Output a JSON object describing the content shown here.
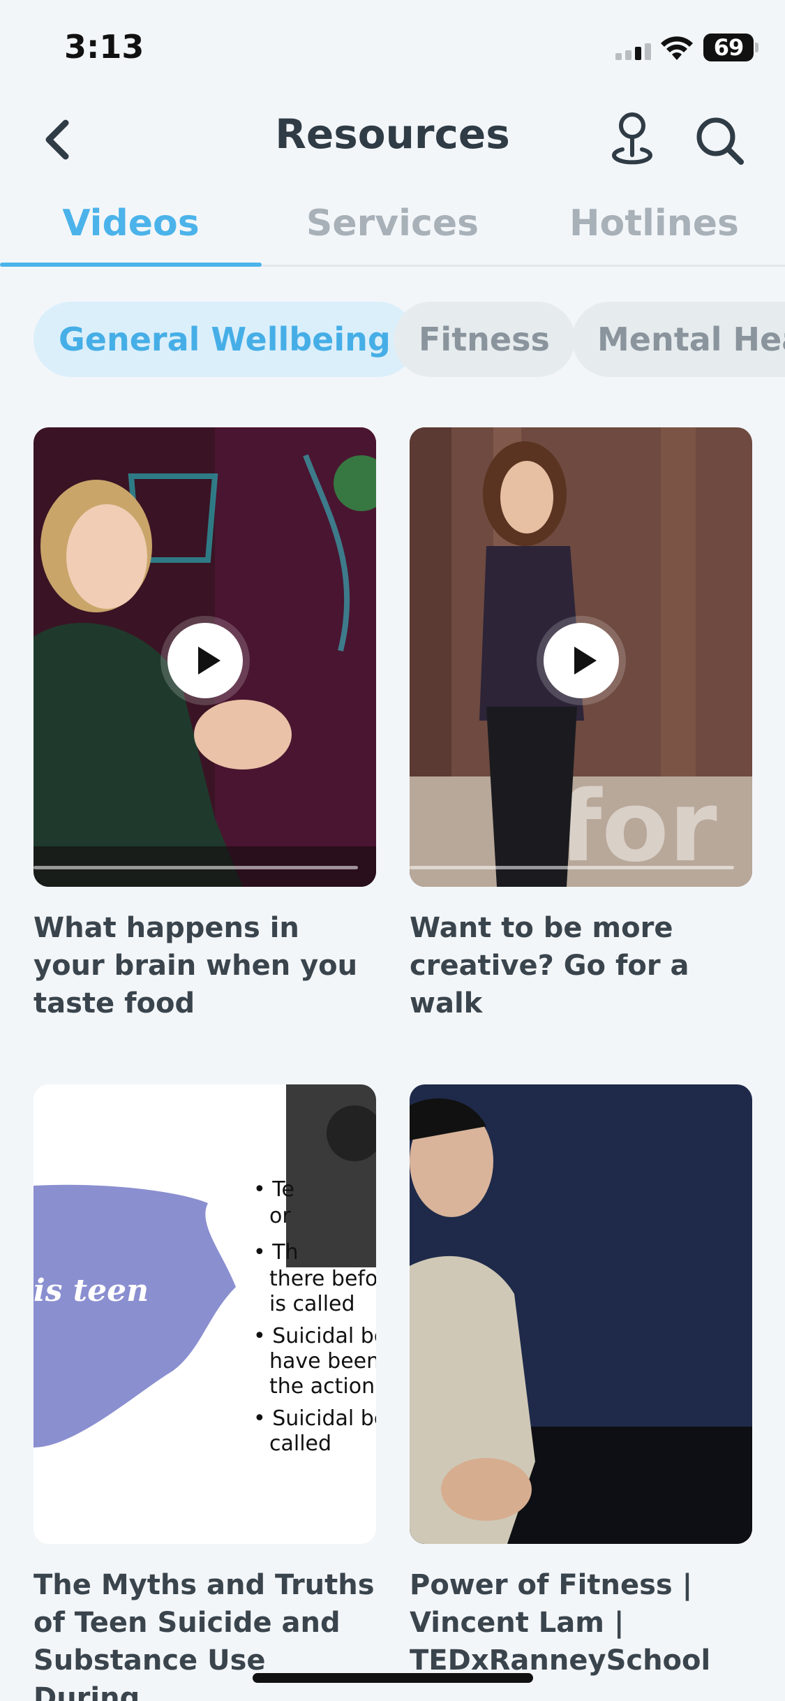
{
  "status_bar": {
    "time": "3:13",
    "battery": "69"
  },
  "header": {
    "title": "Resources"
  },
  "tabs": [
    {
      "label": "Videos",
      "active": true
    },
    {
      "label": "Services",
      "active": false
    },
    {
      "label": "Hotlines",
      "active": false
    }
  ],
  "chips": [
    {
      "label": "General Wellbeing",
      "active": true
    },
    {
      "label": "Fitness",
      "active": false
    },
    {
      "label": "Mental Heal",
      "active": false
    }
  ],
  "videos": [
    {
      "title": "What happens in your brain when you taste food",
      "has_play": true
    },
    {
      "title": "Want to be more creative? Go for a walk",
      "has_play": true
    },
    {
      "title": "The Myths and Truths of Teen Suicide and Substance Use During...",
      "has_play": false
    },
    {
      "title": "Power of Fitness | Vincent Lam | TEDxRanneySchool",
      "has_play": false
    }
  ],
  "colors": {
    "accent": "#4bb3ea",
    "chip_active_bg": "#dbeffb",
    "background": "#f3f6f9"
  }
}
